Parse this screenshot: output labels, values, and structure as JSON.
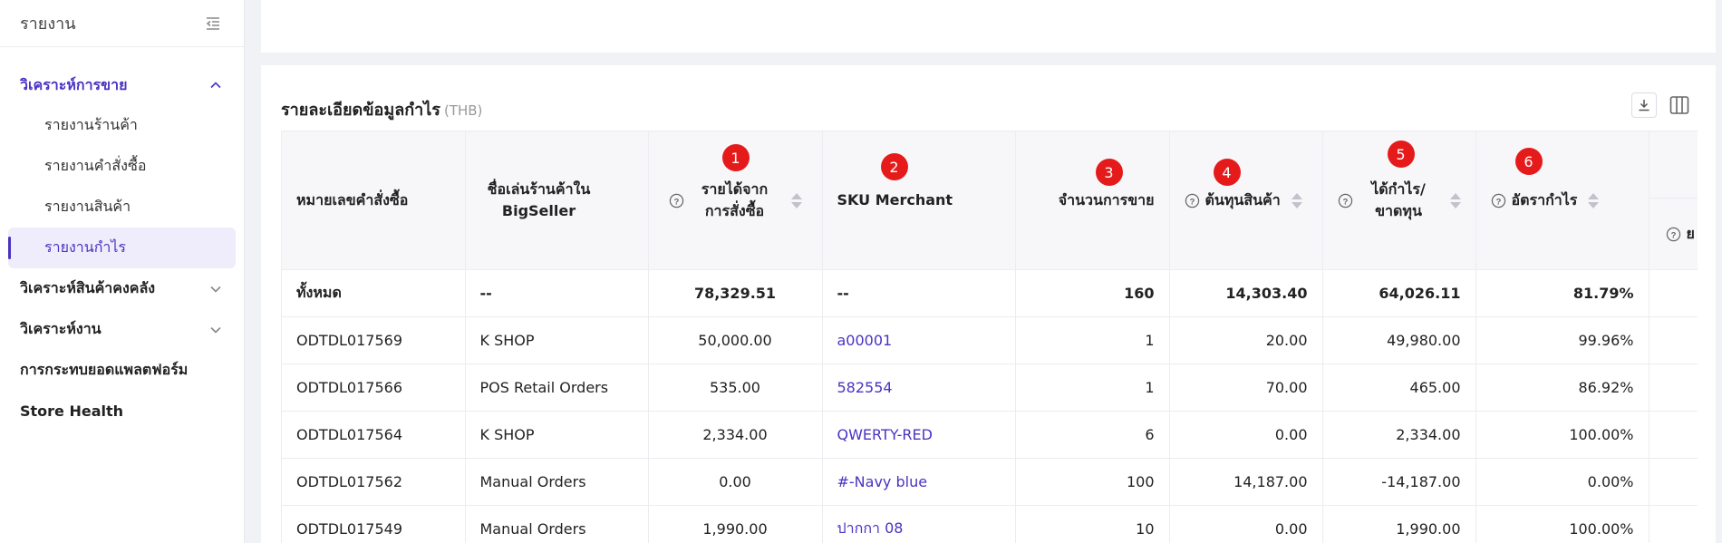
{
  "sidebar": {
    "title": "รายงาน",
    "group": "วิเคราะห์การขาย",
    "sub_items": [
      {
        "label": "รายงานร้านค้า",
        "active": false
      },
      {
        "label": "รายงานคำสั่งซื้อ",
        "active": false
      },
      {
        "label": "รายงานสินค้า",
        "active": false
      },
      {
        "label": "รายงานกำไร",
        "active": true
      }
    ],
    "items": [
      {
        "label": "วิเคราะห์สินค้าคงคลัง",
        "expandable": true
      },
      {
        "label": "วิเคราะห์งาน",
        "expandable": true
      },
      {
        "label": "การกระทบยอดแพลตฟอร์ม",
        "expandable": false
      },
      {
        "label": "Store Health",
        "expandable": false
      }
    ]
  },
  "card": {
    "title": "รายละเอียดข้อมูลกำไร",
    "currency": "(THB)",
    "download_icon": "download-icon",
    "columns_icon": "columns-icon"
  },
  "table": {
    "headers": {
      "order_no": "หมายเลขคำสั่งซื้อ",
      "shop_name": "ชื่อเล่นร้านค้าใน BigSeller",
      "revenue": "รายได้จากการสั่งซื้อ",
      "sku": "SKU Merchant",
      "qty": "จำนวนการขาย",
      "cost": "ต้นทุนสินค้า",
      "profit": "ได้กำไร/ขาดทุน",
      "margin": "อัตรากำไร",
      "extra": "ย"
    },
    "badges": {
      "revenue": "1",
      "sku": "2",
      "qty": "3",
      "cost": "4",
      "profit": "5",
      "margin": "6"
    },
    "total": {
      "order_no": "ทั้งหมด",
      "shop_name": "--",
      "revenue": "78,329.51",
      "sku": "--",
      "qty": "160",
      "cost": "14,303.40",
      "profit": "64,026.11",
      "margin": "81.79%"
    },
    "rows": [
      {
        "order_no": "ODTDL017569",
        "shop_name": "K SHOP",
        "revenue": "50,000.00",
        "sku": "a00001",
        "qty": "1",
        "cost": "20.00",
        "profit": "49,980.00",
        "margin": "99.96%"
      },
      {
        "order_no": "ODTDL017566",
        "shop_name": "POS Retail Orders",
        "revenue": "535.00",
        "sku": "582554",
        "qty": "1",
        "cost": "70.00",
        "profit": "465.00",
        "margin": "86.92%"
      },
      {
        "order_no": "ODTDL017564",
        "shop_name": "K SHOP",
        "revenue": "2,334.00",
        "sku": "QWERTY-RED",
        "qty": "6",
        "cost": "0.00",
        "profit": "2,334.00",
        "margin": "100.00%"
      },
      {
        "order_no": "ODTDL017562",
        "shop_name": "Manual Orders",
        "revenue": "0.00",
        "sku": "#-Navy blue",
        "qty": "100",
        "cost": "14,187.00",
        "profit": "-14,187.00",
        "margin": "0.00%"
      },
      {
        "order_no": "ODTDL017549",
        "shop_name": "Manual Orders",
        "revenue": "1,990.00",
        "sku": "ปากกา 08",
        "qty": "10",
        "cost": "0.00",
        "profit": "1,990.00",
        "margin": "100.00%"
      }
    ]
  },
  "colors": {
    "accent": "#4b32c3",
    "badge": "#e51b1b",
    "active_bg": "#efedfc"
  }
}
